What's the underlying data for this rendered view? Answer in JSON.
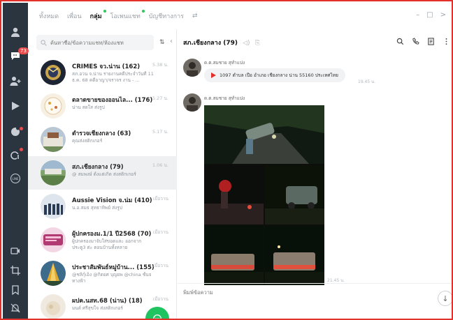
{
  "nav": {
    "unread_badge": "73"
  },
  "tabs": [
    {
      "label": "ทั้งหมด"
    },
    {
      "label": "เพื่อน"
    },
    {
      "label": "กลุ่ม"
    },
    {
      "label": "โอเพนแชท"
    },
    {
      "label": "บัญชีทางการ"
    }
  ],
  "active_tab": "กลุ่ม",
  "search": {
    "placeholder": "ค้นหาชื่อ/ข้อความแชท/ห้องแชท"
  },
  "chats": [
    {
      "name": "CRIMES จว.น่าน (162)",
      "preview": "สภ.อวน จ.น่าน รายงานคดีประจำวันที่ 11 ธ.ค. 68 คดีอาญา/จราจร งาน - ...",
      "time": "5.38 น."
    },
    {
      "name": "ตลาดขายของออนไล... (176)",
      "preview": "น่าน สดใส ส่งรูป",
      "time": "5.27 น."
    },
    {
      "name": "ตำรวจเชียงกลาง (63)",
      "preview": "คุณส่งสติกเกอร์",
      "time": "5.17 น."
    },
    {
      "name": "สภ.เชียงกลาง (79)",
      "preview": "@ สมพงษ์ ตั้งแต่เกิด ส่งสติกเกอร์",
      "time": "1.06 น."
    },
    {
      "name": "Aussie Vision จ.น่ม (410)",
      "preview": "น.อ.สมธ สุทธาทิพย์ ส่งรูป",
      "time": "เมื่อวาน"
    },
    {
      "name": "ผู้ปกครองม.1/1 ปี2568 (70)",
      "preview": "ผู้ปกครองมาจับใส่ขอดและ ออกจากประตู3 ต่ะ ตอนบ้านทั้งหลาย",
      "time": "เมื่อวาน"
    },
    {
      "name": "ประชาสัมพันธ์หมู่บ้าน... (155)",
      "preview": "@ชลิกุ์เอ็ง @กิตยศ บุญยพ @china ชั้นจทางฟ้า",
      "time": "เมื่อวาน"
    },
    {
      "name": "ผปค.นสท.68 (น่าน) (18)",
      "preview": "มนต์ ศรีสุขใจ ส่งสติกเกอร์",
      "time": "เมื่อวาน"
    }
  ],
  "chat": {
    "title": "สภ.เชียงกลาง (79)",
    "messages": [
      {
        "sender": "ด.ต.สมชาย สุทำแปง",
        "text": "1097 ตำบล เปือ อำเภอ เชียงกลาง น่าน 55160 ประเทศไทย",
        "time": "19.45 น."
      },
      {
        "sender": "ด.ต.สมชาย สุทำแปง",
        "time": "21.45 น."
      }
    ],
    "input_placeholder": "พิมพ์ข้อความ"
  },
  "colors": {
    "accent": "#1fc35f",
    "nav_bg": "#2b3540",
    "frame": "#e2312b"
  }
}
